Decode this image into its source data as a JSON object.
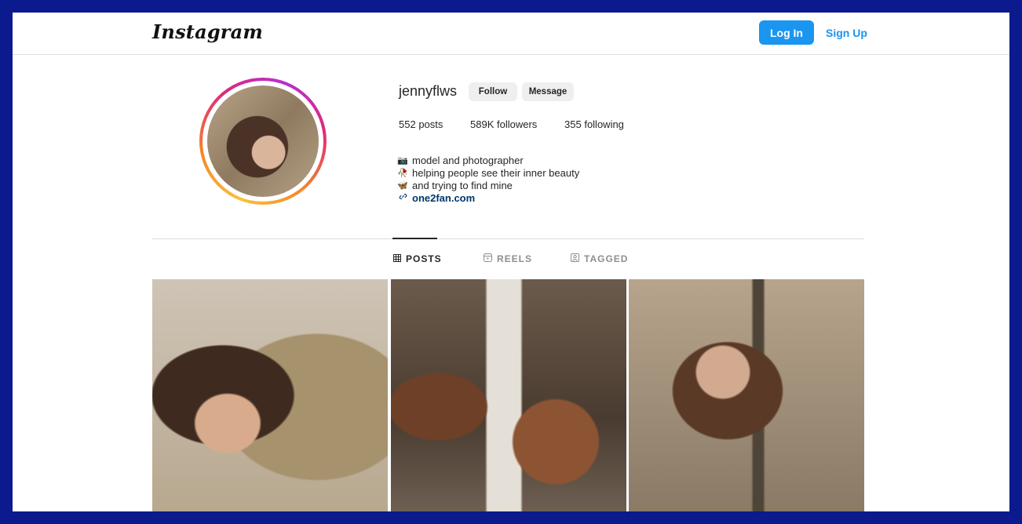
{
  "header": {
    "logo": "Instagram",
    "login_label": "Log In",
    "signup_label": "Sign Up"
  },
  "profile": {
    "username": "jennyflws",
    "follow_label": "Follow",
    "message_label": "Message",
    "stats": {
      "posts_count": "552",
      "posts_label": "posts",
      "followers_count": "589K",
      "followers_label": "followers",
      "following_count": "355",
      "following_label": "following"
    },
    "bio": [
      {
        "emoji": "📷",
        "text": "model and photographer"
      },
      {
        "emoji": "🥀",
        "text": "helping people see their inner beauty"
      },
      {
        "emoji": "🦋",
        "text": "and trying to find mine"
      }
    ],
    "link": {
      "icon": "link-icon",
      "text": "one2fan.com"
    }
  },
  "tabs": [
    {
      "label": "POSTS",
      "icon": "grid-icon",
      "active": true
    },
    {
      "label": "REELS",
      "icon": "reels-icon",
      "active": false
    },
    {
      "label": "TAGGED",
      "icon": "tagged-icon",
      "active": false
    }
  ],
  "colors": {
    "accent": "#1a95f0",
    "page_background": "#0b1a8c",
    "link_text": "#00376b"
  }
}
